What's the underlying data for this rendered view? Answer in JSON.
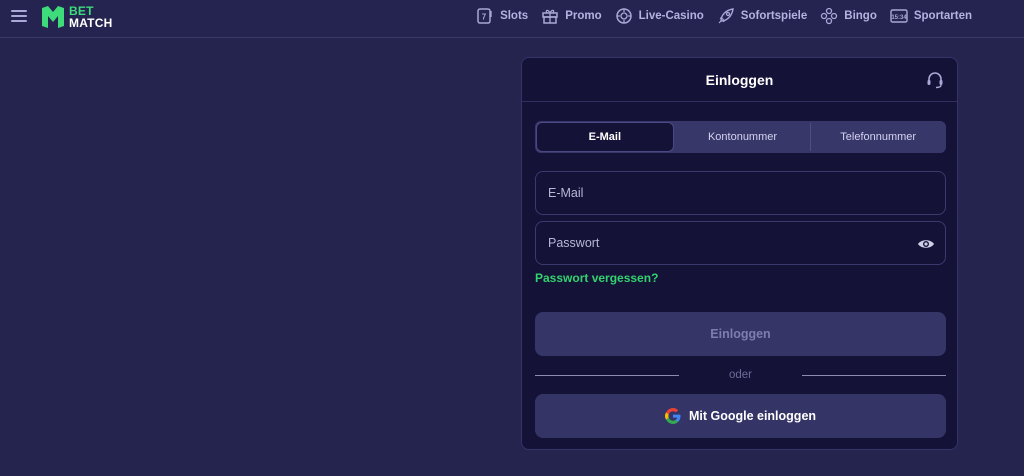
{
  "brand": {
    "line1": "BET",
    "line2": "MATCH"
  },
  "nav": [
    {
      "label": "Slots",
      "icon": "slot-machine-icon"
    },
    {
      "label": "Promo",
      "icon": "gift-icon"
    },
    {
      "label": "Live-Casino",
      "icon": "casino-chip-icon"
    },
    {
      "label": "Sofortspiele",
      "icon": "rocket-icon"
    },
    {
      "label": "Bingo",
      "icon": "bingo-balls-icon"
    },
    {
      "label": "Sportarten",
      "icon": "scoreboard-icon"
    }
  ],
  "login": {
    "title": "Einloggen",
    "tabs": [
      {
        "label": "E-Mail",
        "active": true
      },
      {
        "label": "Kontonummer",
        "active": false
      },
      {
        "label": "Telefonnummer",
        "active": false
      }
    ],
    "email_placeholder": "E-Mail",
    "password_placeholder": "Passwort",
    "forgot_password": "Passwort vergessen?",
    "submit_label": "Einloggen",
    "divider_text": "oder",
    "google_label": "Mit Google einloggen"
  },
  "colors": {
    "background": "#25244f",
    "card": "#141236",
    "accent_green": "#32d26f",
    "nav_text": "#b3b2e0"
  }
}
